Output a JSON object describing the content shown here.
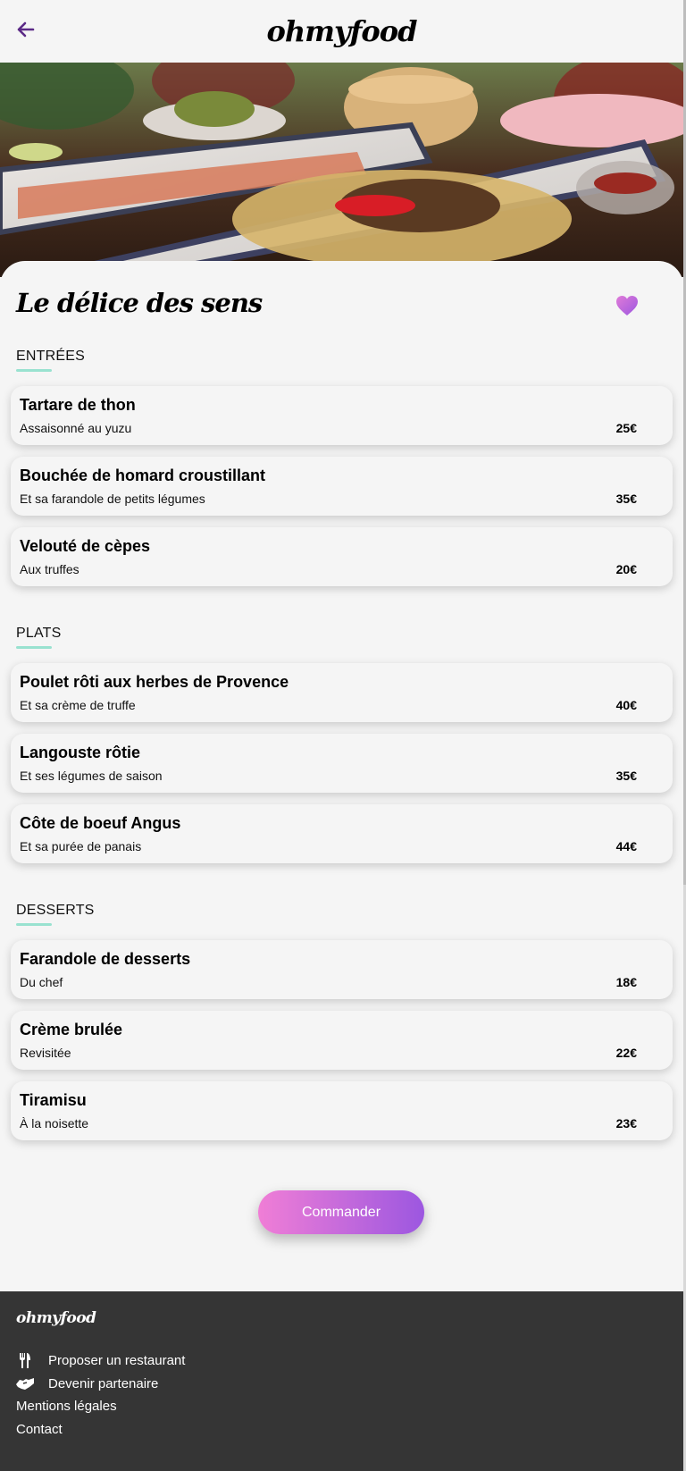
{
  "header": {
    "logo": "ohmyfood",
    "back_icon": "arrow-left-icon",
    "accent_color": "#9c57e0"
  },
  "restaurant": {
    "name": "Le délice des sens",
    "favorite_icon": "heart-icon"
  },
  "sections": [
    {
      "title": "ENTRÉES",
      "dishes": [
        {
          "name": "Tartare de thon",
          "description": "Assaisonné au yuzu",
          "price": "25€"
        },
        {
          "name": "Bouchée de homard croustillant",
          "description": "Et sa farandole de petits légumes",
          "price": "35€"
        },
        {
          "name": "Velouté de cèpes",
          "description": "Aux truffes",
          "price": "20€"
        }
      ]
    },
    {
      "title": "PLATS",
      "dishes": [
        {
          "name": "Poulet rôti aux herbes de Provence",
          "description": "Et sa crème de truffe",
          "price": "40€"
        },
        {
          "name": "Langouste rôtie",
          "description": "Et ses légumes de saison",
          "price": "35€"
        },
        {
          "name": "Côte de boeuf Angus",
          "description": "Et sa purée de panais",
          "price": "44€"
        }
      ]
    },
    {
      "title": "DESSERTS",
      "dishes": [
        {
          "name": "Farandole de desserts",
          "description": "Du chef",
          "price": "18€"
        },
        {
          "name": "Crème brulée",
          "description": "Revisitée",
          "price": "22€"
        },
        {
          "name": "Tiramisu",
          "description": "À la noisette",
          "price": "23€"
        }
      ]
    }
  ],
  "order_button": "Commander",
  "footer": {
    "logo": "ohmyfood",
    "links": [
      {
        "label": "Proposer un restaurant",
        "icon": "utensils-icon"
      },
      {
        "label": "Devenir partenaire",
        "icon": "handshake-icon"
      },
      {
        "label": "Mentions légales"
      },
      {
        "label": "Contact"
      }
    ]
  },
  "colors": {
    "background": "#f5f5f5",
    "footer": "#353535",
    "underline": "#99e2d0",
    "button_start": "#f07ed6",
    "button_end": "#9c57e0"
  }
}
